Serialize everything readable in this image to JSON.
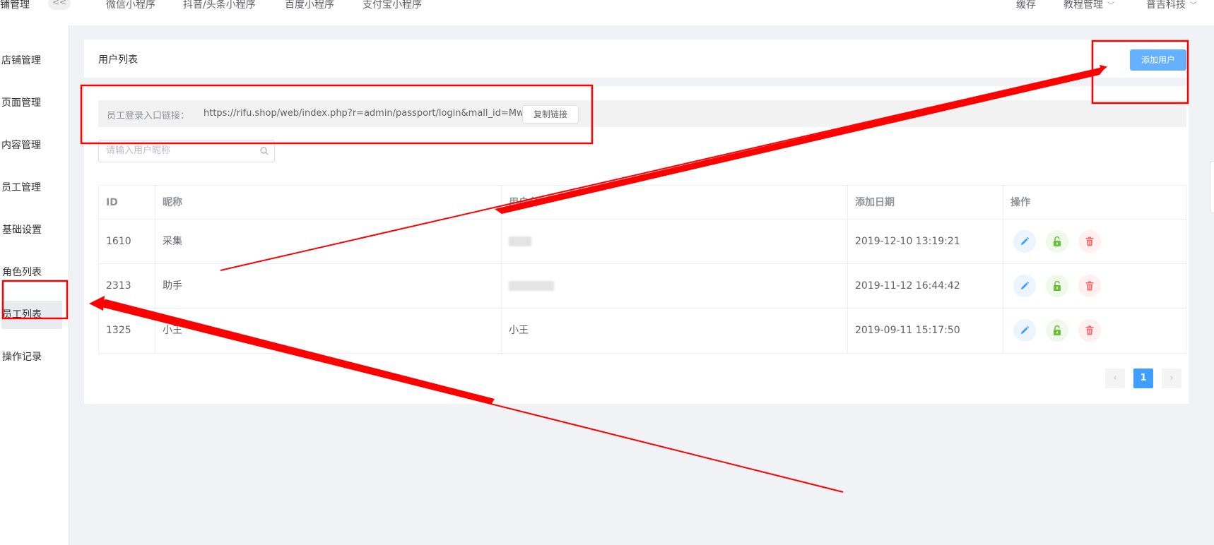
{
  "topbar": {
    "brand": "店铺管理",
    "collapse": "<<",
    "nav": [
      "微信小程序",
      "抖音/头条小程序",
      "百度小程序",
      "支付宝小程序"
    ],
    "right": {
      "cache": "缓存",
      "tutorial": "教程管理",
      "company": "普吉科技"
    }
  },
  "sidebar": {
    "items": [
      {
        "label": "店铺管理"
      },
      {
        "label": "页面管理"
      },
      {
        "label": "内容管理"
      },
      {
        "label": "员工管理"
      },
      {
        "label": "基础设置"
      },
      {
        "label": "角色列表"
      },
      {
        "label": "员工列表",
        "active": true
      },
      {
        "label": "操作记录"
      }
    ]
  },
  "header": {
    "title": "用户列表",
    "add_button": "添加用户"
  },
  "login_link": {
    "label": "员工登录入口链接：",
    "url": "https://rifu.shop/web/index.php?r=admin/passport/login&mall_id=Mw==",
    "copy_button": "复制链接"
  },
  "search": {
    "placeholder": "请输入用户昵称",
    "value": ""
  },
  "table": {
    "columns": [
      "ID",
      "昵称",
      "用户名",
      "添加日期",
      "操作"
    ],
    "rows": [
      {
        "id": "1610",
        "nickname": "采集",
        "username": "",
        "date": "2019-12-10 13:19:21"
      },
      {
        "id": "2313",
        "nickname": "助手",
        "username": "",
        "date": "2019-11-12 16:44:42"
      },
      {
        "id": "1325",
        "nickname": "小王",
        "username": "小王",
        "date": "2019-09-11 15:17:50"
      }
    ]
  },
  "pagination": {
    "prev": "‹",
    "current": "1",
    "next": "›"
  },
  "colors": {
    "primary": "#409eff",
    "annotation": "#ff0000",
    "edit": "#409eff",
    "unlock": "#67c23a",
    "delete": "#f56c6c"
  }
}
